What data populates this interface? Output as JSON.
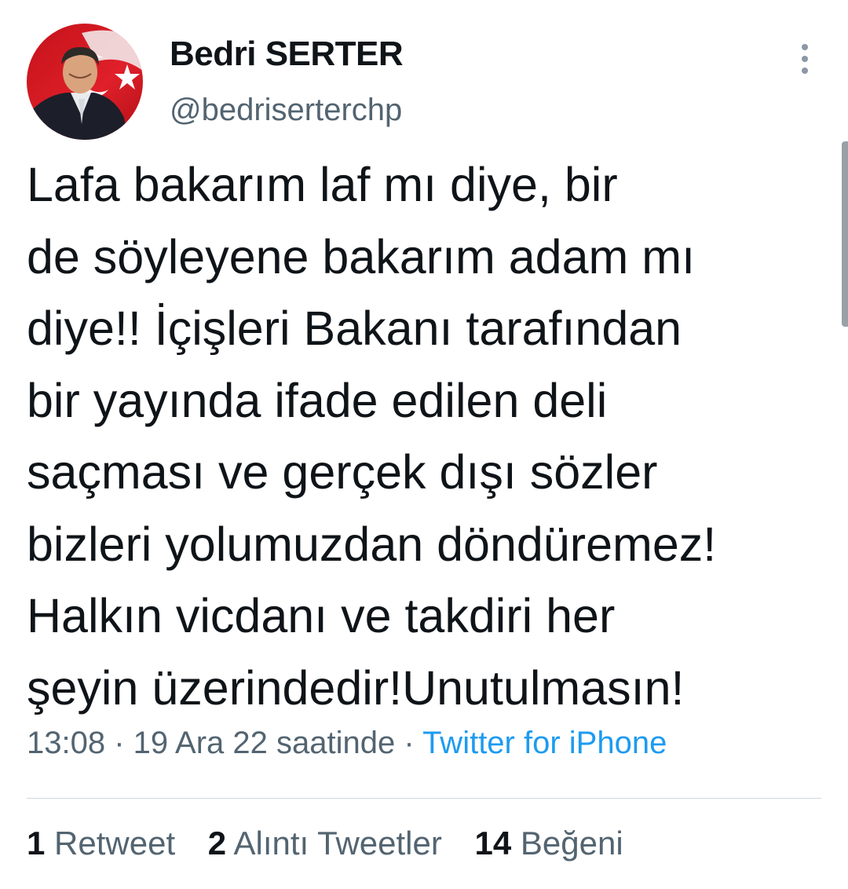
{
  "author": {
    "display_name": "Bedri SERTER",
    "handle": "@bedriserterchp"
  },
  "tweet": {
    "lines": [
      "Lafa bakarım laf mı diye, bir",
      "de söyleyene bakarım adam mı",
      "diye!! İçişleri Bakanı tarafından",
      "bir yayında ifade edilen deli",
      "saçması ve gerçek dışı sözler",
      "bizleri yolumuzdan döndüremez!",
      "Halkın vicdanı ve takdiri her",
      "şeyin üzerindedir!Unutulmasın!"
    ]
  },
  "meta": {
    "time": "13:08",
    "sep1": " · ",
    "date": "19 Ara 22 saatinde",
    "sep2": " · ",
    "source": "Twitter for iPhone"
  },
  "stats": {
    "retweets": {
      "count": "1",
      "label": "Retweet"
    },
    "quotes": {
      "count": "2",
      "label": "Alıntı Tweetler"
    },
    "likes": {
      "count": "14",
      "label": "Beğeni"
    }
  },
  "icons": {
    "more": "more-vertical-icon",
    "avatar": "avatar-image"
  },
  "colors": {
    "text": "#0f1419",
    "secondary": "#536471",
    "link": "#1d9bf0",
    "divider": "#cfd9de"
  }
}
